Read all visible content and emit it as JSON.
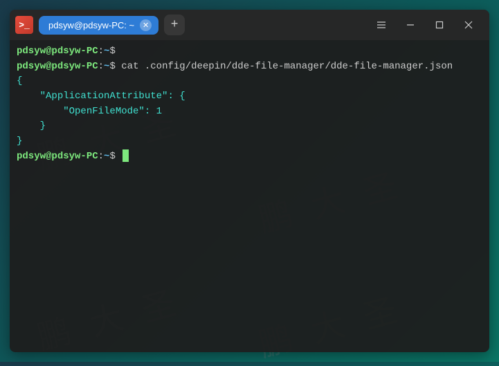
{
  "watermark": "鹏大圣",
  "titlebar": {
    "app_icon_glyph": ">_",
    "tab_title": "pdsyw@pdsyw-PC: ~",
    "tab_close_glyph": "✕",
    "add_tab_glyph": "+"
  },
  "prompt": {
    "user": "pdsyw",
    "at": "@",
    "host": "pdsyw-PC",
    "colon": ":",
    "path": "~",
    "symbol": "$"
  },
  "lines": {
    "command1": "cat .config/deepin/dde-file-manager/dde-file-manager.json",
    "json_l1": "{",
    "json_l2_indent": "    ",
    "json_l2_key": "\"ApplicationAttribute\"",
    "json_l2_rest": ": {",
    "json_l3_indent": "        ",
    "json_l3_key": "\"OpenFileMode\"",
    "json_l3_rest": ": 1",
    "json_l4": "    }",
    "json_l5": "}"
  }
}
